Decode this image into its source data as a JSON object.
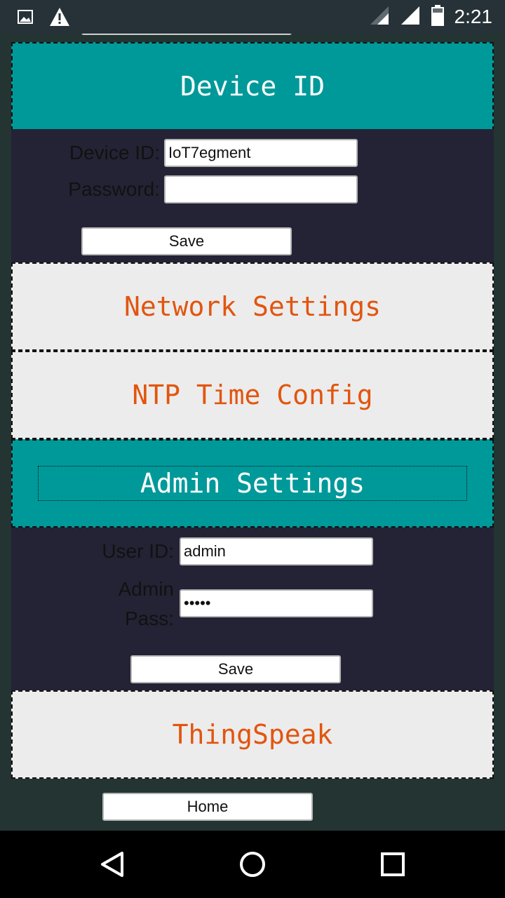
{
  "status_bar": {
    "time": "2:21",
    "icons": [
      "image-notification-icon",
      "warning-icon",
      "signal-icon",
      "signal-icon",
      "battery-icon"
    ]
  },
  "device_section": {
    "title": "Device ID",
    "device_id_label": "Device ID:",
    "device_id_value": "IoT7egment",
    "password_label": "Password:",
    "password_value": "",
    "save_label": "Save"
  },
  "network_section": {
    "title": "Network Settings"
  },
  "ntp_section": {
    "title": "NTP Time Config"
  },
  "admin_section": {
    "title": "Admin Settings",
    "user_id_label": "User ID:",
    "user_id_value": "admin",
    "admin_pass_label_line1": "Admin",
    "admin_pass_label_line2": "Pass:",
    "admin_pass_value": "•••••",
    "save_label": "Save"
  },
  "thingspeak_section": {
    "title": "ThingSpeak"
  },
  "home_label": "Home",
  "nav_bar": {
    "icons": [
      "back-icon",
      "home-circle-icon",
      "recents-icon"
    ]
  },
  "colors": {
    "teal": "#00999a",
    "dark_panel": "#242335",
    "light_panel": "#ececec",
    "orange_text": "#e2550e"
  }
}
